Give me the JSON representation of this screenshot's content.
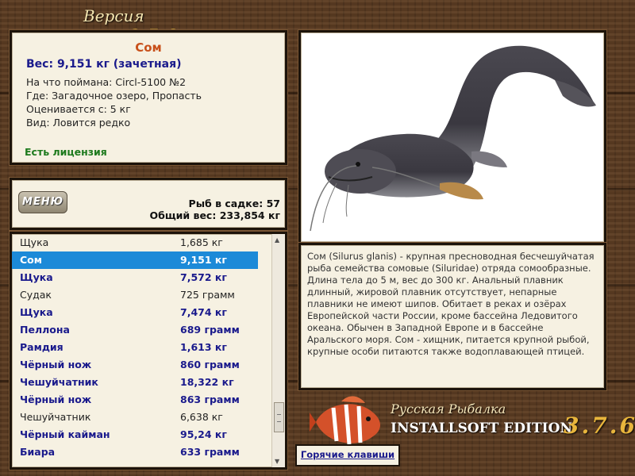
{
  "window": {
    "title_prefix": "Версия игры",
    "title_version": "3.7.6"
  },
  "info": {
    "fish_name": "Сом",
    "weight_line": "Вес: 9,151 кг (зачетная)",
    "bait_line": "На что поймана: Circl-5100 №2",
    "location_line": "Где: Загадочное озеро, Пропасть",
    "valued_from_line": "Оценивается с: 5 кг",
    "rarity_line": "Вид: Ловится редко",
    "license": "Есть лицензия",
    "colors": {
      "fish_name": "#c8501a",
      "weight": "#1a1a8c",
      "license": "#1d7a1d"
    }
  },
  "catch": {
    "menu_label": "МЕНЮ",
    "count_line": "Рыб в садке: 57",
    "total_weight_line": "Общий вес: 233,854 кг"
  },
  "list": {
    "selected_color": "#1c8ad8",
    "rows": [
      {
        "name": "Щука",
        "weight": "1,685 кг",
        "style": "plain"
      },
      {
        "name": "Сом",
        "weight": "9,151 кг",
        "style": "selected"
      },
      {
        "name": "Щука",
        "weight": "7,572 кг",
        "style": "blue"
      },
      {
        "name": "Судак",
        "weight": "725 грамм",
        "style": "plain"
      },
      {
        "name": "Щука",
        "weight": "7,474 кг",
        "style": "blue"
      },
      {
        "name": "Пеллона",
        "weight": "689 грамм",
        "style": "blue"
      },
      {
        "name": "Рамдия",
        "weight": "1,613 кг",
        "style": "blue"
      },
      {
        "name": "Чёрный нож",
        "weight": "860 грамм",
        "style": "blue"
      },
      {
        "name": "Чешуйчатник",
        "weight": "18,322 кг",
        "style": "blue"
      },
      {
        "name": "Чёрный нож",
        "weight": "863 грамм",
        "style": "blue"
      },
      {
        "name": "Чешуйчатник",
        "weight": "6,638 кг",
        "style": "plain"
      },
      {
        "name": "Чёрный кайман",
        "weight": "95,24 кг",
        "style": "blue"
      },
      {
        "name": "Биара",
        "weight": "633 грамм",
        "style": "blue"
      }
    ]
  },
  "description": "Сом (Silurus glanis) - крупная пресноводная бесчешуйчатая рыба семейства сомовые (Siluridae) отряда сомообразные. Длина тела до 5 м, вес до 300 кг. Анальный плавник длинный, жировой плавник отсутствует, непарные плавники не имеют шипов. Обитает в реках и озёрах Европейской части России, кроме бассейна Ледовитого океана. Обычен в Западной Европе и в бассейне Аральского моря. Сом - хищник, питается крупной рыбой, крупные особи питаются также водоплавающей птицей.",
  "branding": {
    "line1": "Русская Рыбалка",
    "line2": "INSTALLSOFT EDITION",
    "version": "3.7.6"
  },
  "hotkeys_label": "Горячие клавиши",
  "icons": {
    "menu": "menu-badge-icon",
    "fish": "catfish-illustration",
    "logo": "redfish-logo-icon"
  }
}
